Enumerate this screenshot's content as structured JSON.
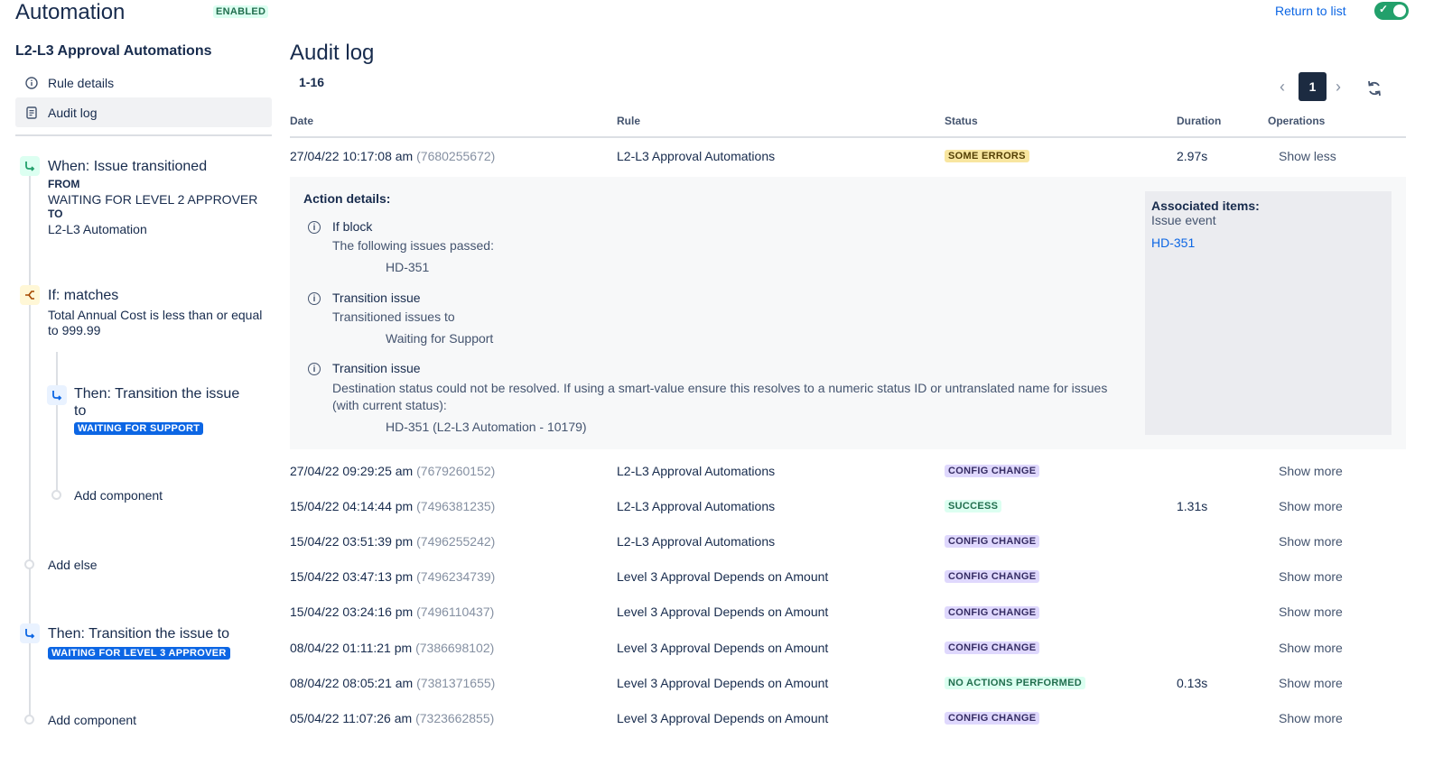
{
  "header": {
    "app_title": "Automation",
    "status_badge": "ENABLED",
    "return_link": "Return to list",
    "toggle_on": true
  },
  "sidebar": {
    "rule_title": "L2-L3 Approval Automations",
    "nav": [
      {
        "label": "Rule details",
        "icon": "info-icon"
      },
      {
        "label": "Audit log",
        "icon": "document-icon",
        "active": true
      }
    ],
    "trigger": {
      "title": "When: Issue transitioned",
      "from_label": "FROM",
      "from_value": "WAITING FOR LEVEL 2 APPROVER",
      "to_label": "TO",
      "to_value": "L2-L3 Automation"
    },
    "condition": {
      "title": "If: matches",
      "text": "Total Annual Cost is less than or equal to 999.99"
    },
    "nested_action": {
      "title_line1": "Then: Transition the issue",
      "title_line2": "to",
      "status": "WAITING FOR SUPPORT"
    },
    "add_component_inner": "Add component",
    "add_else": "Add else",
    "action": {
      "title": "Then: Transition the issue to",
      "status": "WAITING FOR LEVEL 3 APPROVER"
    },
    "add_component": "Add component"
  },
  "main": {
    "title": "Audit log",
    "range": "1-16",
    "current_page": "1",
    "columns": [
      "Date",
      "Rule",
      "Status",
      "Duration",
      "Operations"
    ],
    "rows": [
      {
        "date": "27/04/22 10:17:08 am",
        "id": "(7680255672)",
        "rule": "L2-L3 Approval Automations",
        "status": "SOME ERRORS",
        "status_type": "errors",
        "duration": "2.97s",
        "op": "Show less"
      },
      {
        "date": "27/04/22 09:29:25 am",
        "id": "(7679260152)",
        "rule": "L2-L3 Approval Automations",
        "status": "CONFIG CHANGE",
        "status_type": "config",
        "duration": "",
        "op": "Show more"
      },
      {
        "date": "15/04/22 04:14:44 pm",
        "id": "(7496381235)",
        "rule": "L2-L3 Approval Automations",
        "status": "SUCCESS",
        "status_type": "success",
        "duration": "1.31s",
        "op": "Show more"
      },
      {
        "date": "15/04/22 03:51:39 pm",
        "id": "(7496255242)",
        "rule": "L2-L3 Approval Automations",
        "status": "CONFIG CHANGE",
        "status_type": "config",
        "duration": "",
        "op": "Show more"
      },
      {
        "date": "15/04/22 03:47:13 pm",
        "id": "(7496234739)",
        "rule": "Level 3 Approval Depends on Amount",
        "status": "CONFIG CHANGE",
        "status_type": "config",
        "duration": "",
        "op": "Show more"
      },
      {
        "date": "15/04/22 03:24:16 pm",
        "id": "(7496110437)",
        "rule": "Level 3 Approval Depends on Amount",
        "status": "CONFIG CHANGE",
        "status_type": "config",
        "duration": "",
        "op": "Show more"
      },
      {
        "date": "08/04/22 01:11:21 pm",
        "id": "(7386698102)",
        "rule": "Level 3 Approval Depends on Amount",
        "status": "CONFIG CHANGE",
        "status_type": "config",
        "duration": "",
        "op": "Show more"
      },
      {
        "date": "08/04/22 08:05:21 am",
        "id": "(7381371655)",
        "rule": "Level 3 Approval Depends on Amount",
        "status": "NO ACTIONS PERFORMED",
        "status_type": "none",
        "duration": "0.13s",
        "op": "Show more"
      },
      {
        "date": "05/04/22 11:07:26 am",
        "id": "(7323662855)",
        "rule": "Level 3 Approval Depends on Amount",
        "status": "CONFIG CHANGE",
        "status_type": "config",
        "duration": "",
        "op": "Show more"
      }
    ],
    "details": {
      "heading": "Action details:",
      "items": [
        {
          "title": "If block",
          "text": "The following issues passed:",
          "value": "HD-351"
        },
        {
          "title": "Transition issue",
          "text": "Transitioned issues to",
          "value": "Waiting for Support"
        },
        {
          "title": "Transition issue",
          "text_line1": "Destination status could not be resolved. If using a smart-value ensure this resolves to a numeric status ID or untranslated name for issues",
          "text_line2": "(with current status):",
          "value": "HD-351 (L2-L3 Automation - 10179)"
        }
      ],
      "associated": {
        "title": "Associated items:",
        "subtitle": "Issue event",
        "link": "HD-351"
      }
    }
  },
  "colors": {
    "accent": "#0c66e4",
    "toggle": "#22a06b",
    "page_active": "#1c2b41"
  }
}
